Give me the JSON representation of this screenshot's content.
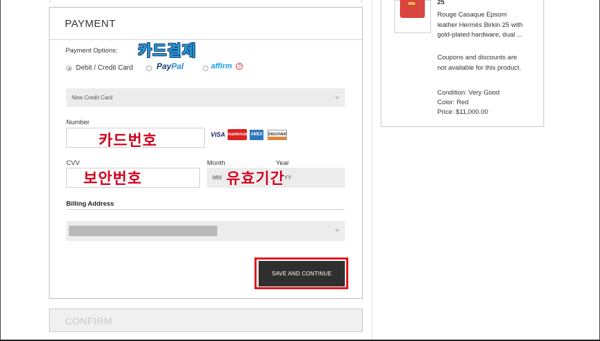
{
  "payment": {
    "title": "PAYMENT",
    "options_label": "Payment Options:",
    "option_card": "Debit / Credit Card",
    "option_paypal_1": "Pay",
    "option_paypal_2": "Pal",
    "option_affirm": "affirm",
    "help": "?",
    "saved_card_select": "New Credit Card",
    "number_label": "Number",
    "cvv_label": "CVV",
    "month_label": "Month",
    "year_label": "Year",
    "month_placeholder": "MM",
    "year_placeholder": "YY",
    "card_brands": [
      "VISA",
      "mastercard",
      "AMEX",
      "DISCOVER"
    ],
    "billing_label": "Billing Address",
    "save_button": "SAVE AND CONTINUE"
  },
  "confirm": {
    "title": "CONFIRM"
  },
  "annotations": {
    "card_payment": "카드결제",
    "card_number": "카드번호",
    "security_code": "보안번호",
    "expiry": "유효기간"
  },
  "summary": {
    "title_tail": "25",
    "description": "Rouge Casaque Epsom leather Hermès Birkin 25 with gold-plated hardware, dual ...",
    "coupon_note": "Coupons and discounts are not available for this product.",
    "condition": "Condition: Very Good",
    "color": "Color: Red",
    "price": "Price: $11,000.00"
  },
  "colors": {
    "highlight_red": "#e4141b",
    "annotation_red": "#d0001d",
    "annotation_blue": "#2a9fd6",
    "button_dark": "#2f2f2f"
  }
}
